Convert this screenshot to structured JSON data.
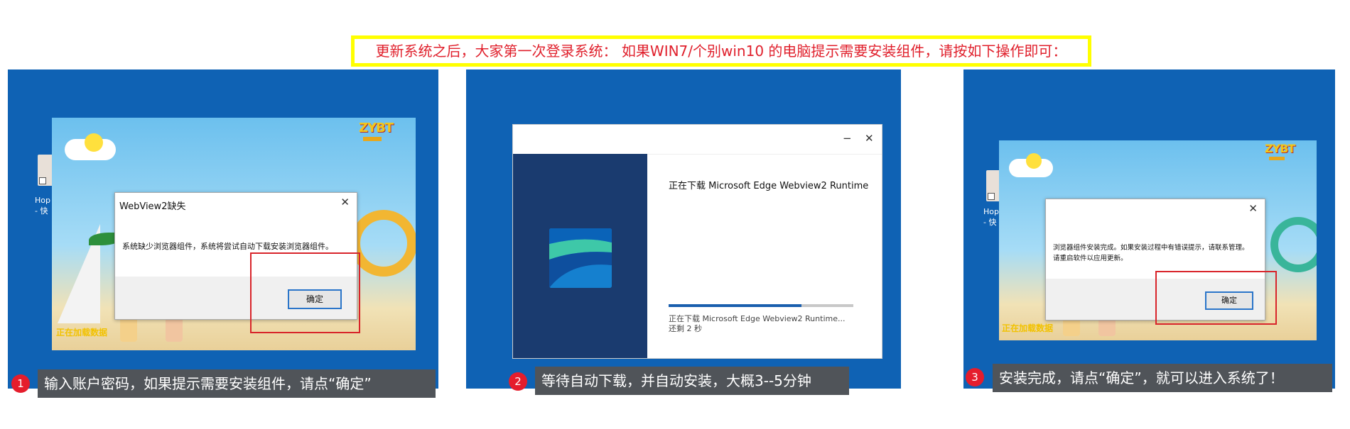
{
  "notice": "更新系统之后，大家第一次登录系统： 如果WIN7/个别win10 的电脑提示需要安装组件，请按如下操作即可：",
  "desktop": {
    "icon_label_1": "Hop",
    "icon_label_2": "- 快",
    "icon_label_3": "Hop",
    "icon_label_4": "- 快"
  },
  "scene": {
    "logo": "ZYBT",
    "footer_text_1": "正在加载数据",
    "footer_text_2": "正在加载数据"
  },
  "step1": {
    "number": "1",
    "dialog_title": "WebView2缺失",
    "dialog_close": "✕",
    "dialog_message": "系统缺少浏览器组件，系统将尝试自动下载安装浏览器组件。",
    "ok_button": "确定",
    "caption": "输入账户密码，如果提示需要安装组件，请点“确定”"
  },
  "step2": {
    "number": "2",
    "minimize": "−",
    "close": "✕",
    "title": "正在下载 Microsoft Edge Webview2 Runtime",
    "progress": 0.72,
    "status": "正在下载 Microsoft Edge Webview2 Runtime... 还剩 2 秒",
    "caption": "等待自动下载，并自动安装，大概3--5分钟"
  },
  "step3": {
    "number": "3",
    "dialog_close": "✕",
    "dialog_message_1": "浏览器组件安装完成。如果安装过程中有错误提示，请联系管理。",
    "dialog_message_2": "请重启软件以应用更新。",
    "ok_button": "确定",
    "caption": "安装完成，请点“确定”，就可以进入系统了！"
  },
  "colors": {
    "panel_blue": "#0f62b4",
    "highlight_red": "#d8242a",
    "notice_border": "#ffff00",
    "notice_text": "#e0202c"
  }
}
